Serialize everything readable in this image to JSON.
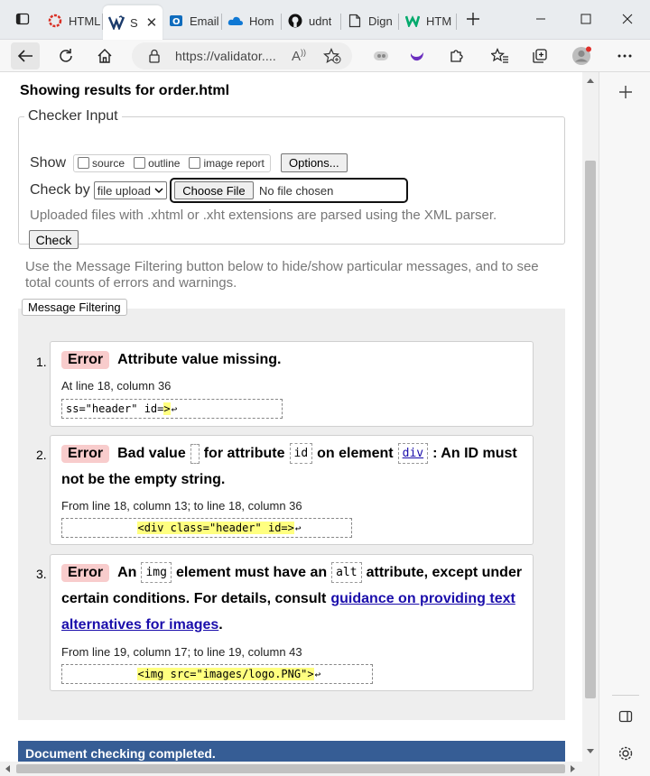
{
  "browser": {
    "tabs": [
      {
        "label": "HTML",
        "icon": "vivaldi-like-red-ring-icon"
      },
      {
        "label": "S",
        "icon": "w3c-validator-icon"
      },
      {
        "label": "Email",
        "icon": "outlook-icon"
      },
      {
        "label": "Hom",
        "icon": "onedrive-cloud-icon"
      },
      {
        "label": "udnt",
        "icon": "github-icon"
      },
      {
        "label": "Dign",
        "icon": "document-icon"
      },
      {
        "label": "HTM",
        "icon": "w3schools-icon"
      }
    ],
    "url": "https://validator....",
    "colors": {
      "accent": "#365d95",
      "badge": "#f8cccc",
      "highlight": "#ffff80",
      "link": "#1a0dab"
    }
  },
  "page": {
    "results_title": "Showing results for order.html",
    "checker": {
      "legend": "Checker Input",
      "show_label": "Show",
      "options": [
        "source",
        "outline",
        "image report"
      ],
      "options_button": "Options...",
      "check_by_label": "Check by",
      "check_by_value": "file upload",
      "choose_file": "Choose File",
      "no_file": "No file chosen",
      "xml_note": "Uploaded files with .xhtml or .xht extensions are parsed using the XML parser.",
      "check_button": "Check"
    },
    "filter_note": "Use the Message Filtering button below to hide/show particular messages, and to see total counts of errors and warnings.",
    "filter_button": "Message Filtering",
    "messages": [
      {
        "num": "1.",
        "badge": "Error",
        "text": "Attribute value missing.",
        "location": "At line 18, column 36",
        "extract_pre": "ss=\"header\" id=",
        "extract_hl": ">",
        "lf": "↩"
      },
      {
        "num": "2.",
        "badge": "Error",
        "t1": "Bad value",
        "t2": "for attribute",
        "code_id": "id",
        "t3": "on element",
        "code_div": "div",
        "t4": ": An ID must",
        "t5": "not be the empty string.",
        "location": "From line 18, column 13; to line 18, column 36",
        "extract_pre": "           ",
        "extract_hl": "<div class=\"header\" id=>",
        "lf": "↩"
      },
      {
        "num": "3.",
        "badge": "Error",
        "t1": "An",
        "code_img": "img",
        "t2": "element must have an",
        "code_alt": "alt",
        "t3": "attribute, except under",
        "t4": "certain conditions. For details, consult",
        "link1": "guidance on providing text",
        "link2": "alternatives for images",
        "t5": ".",
        "location": "From line 19, column 17; to line 19, column 43",
        "extract_pre": "           ",
        "extract_hl": "<img src=\"images/logo.PNG\">",
        "lf": "↩"
      }
    ],
    "completed": "Document checking completed."
  }
}
